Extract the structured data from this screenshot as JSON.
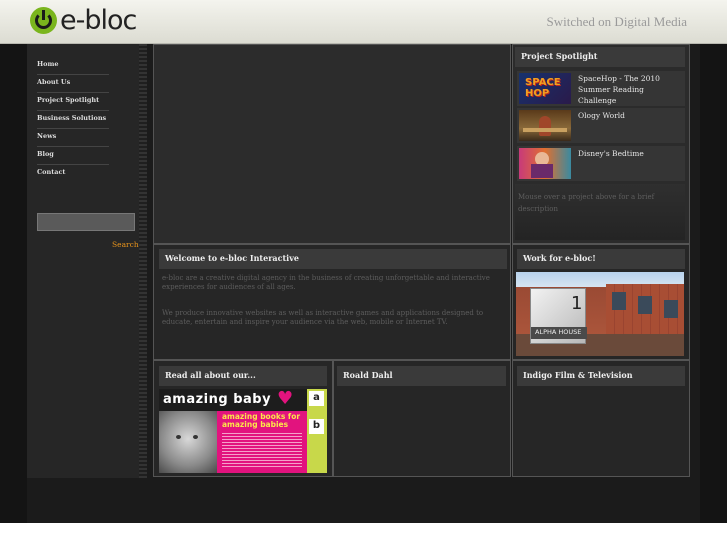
{
  "header": {
    "logo_text": "e-bloc",
    "tagline": "Switched on Digital Media"
  },
  "nav": {
    "items": [
      "Home",
      "About Us",
      "Project Spotlight",
      "Business Solutions",
      "News",
      "Blog",
      "Contact"
    ]
  },
  "search": {
    "placeholder": "",
    "button_label": "Search"
  },
  "spotlight": {
    "title": "Project Spotlight",
    "items": [
      {
        "title": "SpaceHop - The 2010 Summer Reading Challenge",
        "thumb_text": "SPACE HOP"
      },
      {
        "title": "Ology World"
      },
      {
        "title": "Disney's Bedtime"
      }
    ],
    "hint": "Mouse over a project above for a brief description"
  },
  "welcome": {
    "title": "Welcome to e-bloc Interactive",
    "para1": "e-bloc are a creative digital agency in the business of creating unforgettable and interactive experiences for audiences of all ages.",
    "para2": "We produce innovative websites as well as interactive games and applications designed to educate, entertain and inspire your audience via the web, mobile or Internet TV."
  },
  "work": {
    "title": "Work for e-bloc!",
    "sign_number": "1",
    "sign_text": "ALPHA HOUSE"
  },
  "readall": {
    "title": "Read all about our...",
    "banner_title": "amazing baby",
    "banner_sub": "amazing books for amazing babies",
    "side_letters": [
      "a",
      "b"
    ]
  },
  "roald": {
    "title": "Roald Dahl"
  },
  "indigo": {
    "title": "Indigo Film & Television"
  },
  "colors": {
    "accent": "#e8941c",
    "logo_green": "#7ab51d",
    "pink": "#e2137e"
  }
}
